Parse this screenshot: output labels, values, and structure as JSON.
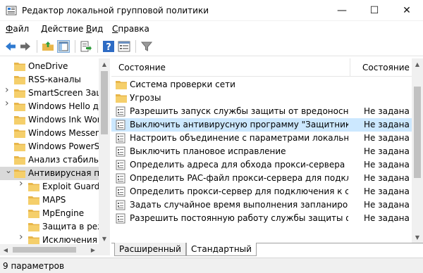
{
  "window": {
    "title": "Редактор локальной групповой политики",
    "minimize_glyph": "—",
    "maximize_glyph": "☐",
    "close_glyph": "✕"
  },
  "menu": [
    {
      "prefix": "",
      "accel": "Ф",
      "rest": "айл"
    },
    {
      "prefix": "",
      "accel": "Д",
      "rest": "ействие"
    },
    {
      "prefix": "",
      "accel": "В",
      "rest": "ид"
    },
    {
      "prefix": "",
      "accel": "С",
      "rest": "правка"
    }
  ],
  "toolbar": {
    "icons": [
      "back-arrow-icon",
      "forward-arrow-icon",
      "up-folder-icon",
      "show-hide-tree-icon",
      "export-list-icon",
      "help-icon",
      "properties-icon",
      "filter-icon"
    ]
  },
  "tree": {
    "items": [
      {
        "label": "OneDrive",
        "level": 0,
        "expandable": false,
        "expanded": false,
        "selected": false
      },
      {
        "label": "RSS-каналы",
        "level": 0,
        "expandable": false,
        "expanded": false,
        "selected": false
      },
      {
        "label": "SmartScreen Защи",
        "level": 0,
        "expandable": true,
        "expanded": false,
        "selected": false
      },
      {
        "label": "Windows Hello дл",
        "level": 0,
        "expandable": true,
        "expanded": false,
        "selected": false
      },
      {
        "label": "Windows Ink Worl",
        "level": 0,
        "expandable": false,
        "expanded": false,
        "selected": false
      },
      {
        "label": "Windows Messeng",
        "level": 0,
        "expandable": false,
        "expanded": false,
        "selected": false
      },
      {
        "label": "Windows PowerSh",
        "level": 0,
        "expandable": false,
        "expanded": false,
        "selected": false
      },
      {
        "label": "Анализ стабильн",
        "level": 0,
        "expandable": false,
        "expanded": false,
        "selected": false
      },
      {
        "label": "Антивирусная пр",
        "level": 0,
        "expandable": true,
        "expanded": true,
        "selected": true
      },
      {
        "label": "Exploit Guard н",
        "level": 1,
        "expandable": true,
        "expanded": false,
        "selected": false
      },
      {
        "label": "MAPS",
        "level": 1,
        "expandable": false,
        "expanded": false,
        "selected": false
      },
      {
        "label": "MpEngine",
        "level": 1,
        "expandable": false,
        "expanded": false,
        "selected": false
      },
      {
        "label": "Защита в реж",
        "level": 1,
        "expandable": false,
        "expanded": false,
        "selected": false
      },
      {
        "label": "Исключения",
        "level": 1,
        "expandable": true,
        "expanded": false,
        "selected": false
      },
      {
        "label": "Исправление",
        "level": 1,
        "expandable": false,
        "expanded": false,
        "selected": false
      }
    ]
  },
  "list": {
    "columns": {
      "name": "Состояние",
      "state": "Состояние"
    },
    "rows": [
      {
        "icon": "folder-icon",
        "name": "Система проверки сети",
        "state": "",
        "selected": false
      },
      {
        "icon": "folder-icon",
        "name": "Угрозы",
        "state": "",
        "selected": false
      },
      {
        "icon": "policy-setting-icon",
        "name": "Разрешить запуск службы защиты от вредоносных пр...",
        "state": "Не задана",
        "selected": false
      },
      {
        "icon": "policy-setting-icon",
        "name": "Выключить антивирусную программу \"Защитник Wi...",
        "state": "Не задана",
        "selected": true
      },
      {
        "icon": "policy-setting-icon",
        "name": "Настроить объединение с параметрами локального а...",
        "state": "Не задана",
        "selected": false
      },
      {
        "icon": "policy-setting-icon",
        "name": "Выключить плановое исправление",
        "state": "Не задана",
        "selected": false
      },
      {
        "icon": "policy-setting-icon",
        "name": "Определить адреса для обхода прокси-сервера",
        "state": "Не задана",
        "selected": false
      },
      {
        "icon": "policy-setting-icon",
        "name": "Определить PAC-файл прокси-сервера для подключе...",
        "state": "Не задана",
        "selected": false
      },
      {
        "icon": "policy-setting-icon",
        "name": "Определить прокси-сервер для подключения к сети",
        "state": "Не задана",
        "selected": false
      },
      {
        "icon": "policy-setting-icon",
        "name": "Задать случайное время выполнения запланированн...",
        "state": "Не задана",
        "selected": false
      },
      {
        "icon": "policy-setting-icon",
        "name": "Разрешить постоянную работу службы защиты от вр...",
        "state": "Не задана",
        "selected": false
      }
    ]
  },
  "tabs": [
    {
      "label": "Расширенный",
      "active": false
    },
    {
      "label": "Стандартный",
      "active": true
    }
  ],
  "status": {
    "text": "9 параметров"
  },
  "colors": {
    "selected_row": "#cce8ff",
    "tree_selected": "#d9d9d9",
    "folder": "#e8b64a"
  }
}
